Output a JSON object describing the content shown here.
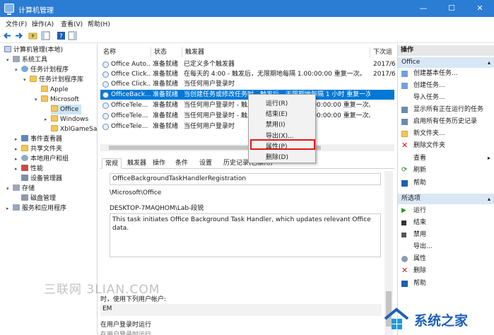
{
  "window": {
    "title": "计算机管理",
    "minimize": "—",
    "maximize": "☐",
    "close": "✕"
  },
  "menu": [
    "文件(F)",
    "操作(A)",
    "查看(V)",
    "帮助(H)"
  ],
  "tree": [
    {
      "label": "计算机管理(本地)"
    },
    {
      "label": "系统工具"
    },
    {
      "label": "任务计划程序"
    },
    {
      "label": "任务计划程序库"
    },
    {
      "label": "Apple"
    },
    {
      "label": "Microsoft"
    },
    {
      "label": "Office"
    },
    {
      "label": "Windows"
    },
    {
      "label": "XblGameSa"
    },
    {
      "label": "事件查看器"
    },
    {
      "label": "共享文件夹"
    },
    {
      "label": "本地用户和组"
    },
    {
      "label": "性能"
    },
    {
      "label": "设备管理器"
    },
    {
      "label": "存储"
    },
    {
      "label": "磁盘管理"
    },
    {
      "label": "服务和应用程序"
    }
  ],
  "task_list": {
    "columns": [
      "名称",
      "状态",
      "触发器",
      "下次运"
    ],
    "rows": [
      {
        "name": "Office Auto...",
        "status": "准备就绪",
        "trigger": "已定义多个触发器",
        "next": "2017/6"
      },
      {
        "name": "Office Click...",
        "status": "准备就绪",
        "trigger": "在每天的 4:00 - 触发后，无限期地每隔 1.00:00:00 重复一次。",
        "next": "2017/6"
      },
      {
        "name": "Office Click...",
        "status": "准备就绪",
        "trigger": "当任何用户登录时",
        "next": ""
      },
      {
        "name": "OfficeBack...",
        "status": "准备就绪",
        "trigger": "当创建任务或修改任务时 - 触发后，无限期地每隔 1 小时 重复一次。",
        "next": ""
      },
      {
        "name": "OfficeTele...",
        "status": "准备就绪",
        "trigger": "当任何用户登录时 - 触发后，无限期地每隔 1.00:00:00 重复一次。",
        "next": ""
      },
      {
        "name": "OfficeTele...",
        "status": "准备就绪",
        "trigger": "当任何用户登录时 - 触发后，无限期地每隔 1.00:00:00 重复一次。",
        "next": ""
      },
      {
        "name": "OfficeTele...",
        "status": "准备就绪",
        "trigger": "当任何用户登录时",
        "next": ""
      }
    ]
  },
  "detail": {
    "tabs": [
      "常规",
      "触发器",
      "操作",
      "条件",
      "设置",
      "历史记录(已禁用)"
    ],
    "task_name": "OfficeBackgroundTaskHandlerRegistration",
    "location": "\\Microsoft\\Office",
    "author": "DESKTOP-7MAQHOM\\Lab-段锐",
    "description": "This task initiates Office Background Task Handler, which updates relevant Office data.",
    "security_label": "时，使用下列用户帐户:",
    "security_value": "EM",
    "run_label": "在用户登录时运行",
    "run_extra": "在用户登录时运行"
  },
  "context_menu": [
    "运行(R)",
    "结束(E)",
    "禁用(I)",
    "导出(X)...",
    "属性(P)",
    "删除(D)"
  ],
  "actions": {
    "header": "操作",
    "section1": "Office",
    "items1": [
      "创建基本任务...",
      "创建任务...",
      "导入任务...",
      "显示所有正在运行的任务",
      "启用所有任务历史记录",
      "新文件夹...",
      "删除文件夹",
      "查看",
      "刷新",
      "帮助"
    ],
    "section2": "所选项",
    "items2": [
      "运行",
      "结束",
      "禁用",
      "导出...",
      "属性",
      "删除",
      "帮助"
    ]
  },
  "watermark": "三联网 3LIAN.COM",
  "logo": "系统之家",
  "colors": {
    "title_bar": "#2b7cd3",
    "selection": "#0078d7",
    "highlight_box": "#e01818"
  }
}
